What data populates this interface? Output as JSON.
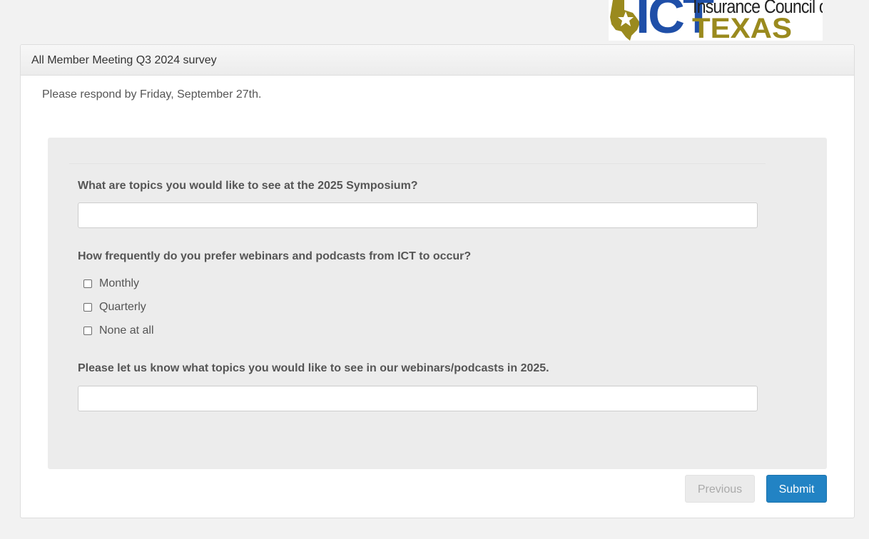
{
  "logo": {
    "mark": "ICT",
    "line1": "Insurance Council of",
    "line2": "TEXAS",
    "colors": {
      "ict": "#1f4fa8",
      "texas": "#9a8a1e",
      "star": "#9a8a1e"
    }
  },
  "panel": {
    "title": "All Member Meeting Q3 2024 survey",
    "intro": "Please respond by Friday, September 27th."
  },
  "questions": [
    {
      "label": "What are topics you would like to see at the 2025 Symposium?",
      "type": "text",
      "value": ""
    },
    {
      "label": "How frequently do you prefer webinars and podcasts from ICT to occur?",
      "type": "checkbox",
      "options": [
        {
          "label": "Monthly",
          "checked": false
        },
        {
          "label": "Quarterly",
          "checked": false
        },
        {
          "label": "None at all",
          "checked": false
        }
      ]
    },
    {
      "label": "Please let us know what topics you would like to see in our webinars/podcasts in 2025.",
      "type": "text",
      "value": ""
    }
  ],
  "buttons": {
    "previous": "Previous",
    "submit": "Submit"
  },
  "colors": {
    "accent": "#2283c4",
    "background": "#f2f2f2",
    "well": "#ececec"
  }
}
